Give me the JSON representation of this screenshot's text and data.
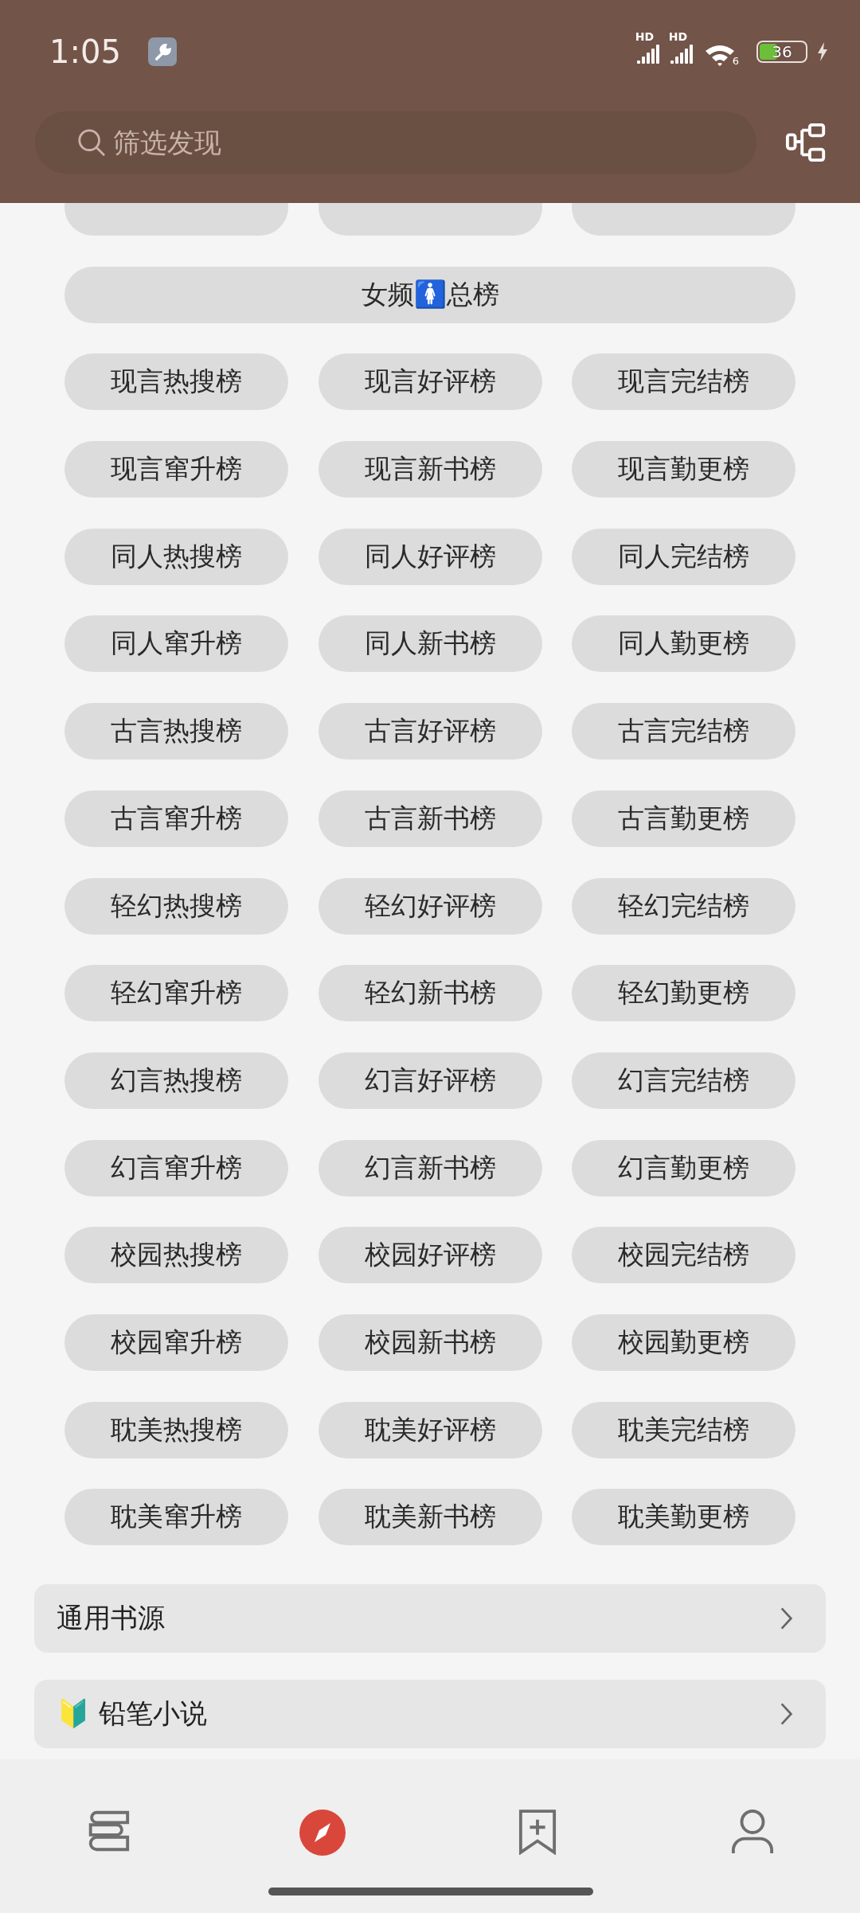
{
  "status_bar": {
    "time": "1:05",
    "signal_labels": [
      "HD",
      "HD"
    ],
    "wifi_label": "6",
    "battery": "36",
    "charging": true
  },
  "search": {
    "placeholder": "筛选发现"
  },
  "chips": [
    {
      "wide": false
    },
    {
      "wide": false
    },
    {
      "wide": false
    },
    {
      "label": "女频🚺总榜",
      "wide": true
    },
    {
      "label": "现言热搜榜",
      "wide": false
    },
    {
      "label": "现言好评榜",
      "wide": false
    },
    {
      "label": "现言完结榜",
      "wide": false
    },
    {
      "label": "现言窜升榜",
      "wide": false
    },
    {
      "label": "现言新书榜",
      "wide": false
    },
    {
      "label": "现言勤更榜",
      "wide": false
    },
    {
      "label": "同人热搜榜",
      "wide": false
    },
    {
      "label": "同人好评榜",
      "wide": false
    },
    {
      "label": "同人完结榜",
      "wide": false
    },
    {
      "label": "同人窜升榜",
      "wide": false
    },
    {
      "label": "同人新书榜",
      "wide": false
    },
    {
      "label": "同人勤更榜",
      "wide": false
    },
    {
      "label": "古言热搜榜",
      "wide": false
    },
    {
      "label": "古言好评榜",
      "wide": false
    },
    {
      "label": "古言完结榜",
      "wide": false
    },
    {
      "label": "古言窜升榜",
      "wide": false
    },
    {
      "label": "古言新书榜",
      "wide": false
    },
    {
      "label": "古言勤更榜",
      "wide": false
    },
    {
      "label": "轻幻热搜榜",
      "wide": false
    },
    {
      "label": "轻幻好评榜",
      "wide": false
    },
    {
      "label": "轻幻完结榜",
      "wide": false
    },
    {
      "label": "轻幻窜升榜",
      "wide": false
    },
    {
      "label": "轻幻新书榜",
      "wide": false
    },
    {
      "label": "轻幻勤更榜",
      "wide": false
    },
    {
      "label": "幻言热搜榜",
      "wide": false
    },
    {
      "label": "幻言好评榜",
      "wide": false
    },
    {
      "label": "幻言完结榜",
      "wide": false
    },
    {
      "label": "幻言窜升榜",
      "wide": false
    },
    {
      "label": "幻言新书榜",
      "wide": false
    },
    {
      "label": "幻言勤更榜",
      "wide": false
    },
    {
      "label": "校园热搜榜",
      "wide": false
    },
    {
      "label": "校园好评榜",
      "wide": false
    },
    {
      "label": "校园完结榜",
      "wide": false
    },
    {
      "label": "校园窜升榜",
      "wide": false
    },
    {
      "label": "校园新书榜",
      "wide": false
    },
    {
      "label": "校园勤更榜",
      "wide": false
    },
    {
      "label": "耽美热搜榜",
      "wide": false
    },
    {
      "label": "耽美好评榜",
      "wide": false
    },
    {
      "label": "耽美完结榜",
      "wide": false
    },
    {
      "label": "耽美窜升榜",
      "wide": false
    },
    {
      "label": "耽美新书榜",
      "wide": false
    },
    {
      "label": "耽美勤更榜",
      "wide": false
    }
  ],
  "sources": [
    {
      "label": "通用书源"
    },
    {
      "label": "🔰 铅笔小说"
    }
  ],
  "nav": [
    {
      "kind": "bookshelf",
      "selected": false
    },
    {
      "kind": "explore",
      "selected": true
    },
    {
      "kind": "bookmark",
      "selected": false
    },
    {
      "kind": "profile",
      "selected": false
    }
  ]
}
